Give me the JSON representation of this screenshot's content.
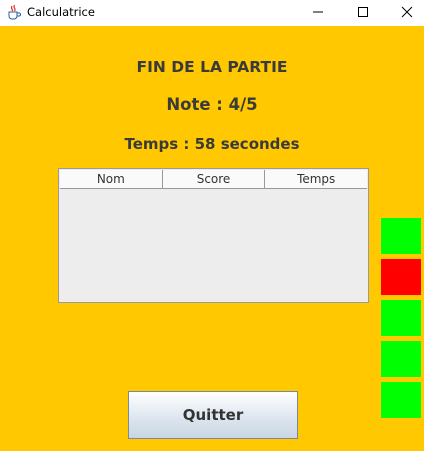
{
  "window": {
    "title": "Calculatrice",
    "icon": "java-cup-icon"
  },
  "result": {
    "end_title": "FIN DE LA PARTIE",
    "score_text": "Note : 4/5",
    "time_text": "Temps : 58 secondes"
  },
  "table": {
    "columns": [
      "Nom",
      "Score",
      "Temps"
    ],
    "rows": []
  },
  "indicators": [
    {
      "status": "correct",
      "color": "#00ff00"
    },
    {
      "status": "incorrect",
      "color": "#ff0000"
    },
    {
      "status": "correct",
      "color": "#00ff00"
    },
    {
      "status": "correct",
      "color": "#00ff00"
    },
    {
      "status": "correct",
      "color": "#00ff00"
    }
  ],
  "buttons": {
    "quit_label": "Quitter"
  },
  "colors": {
    "background": "#ffc800",
    "text": "#3a3a3a"
  }
}
